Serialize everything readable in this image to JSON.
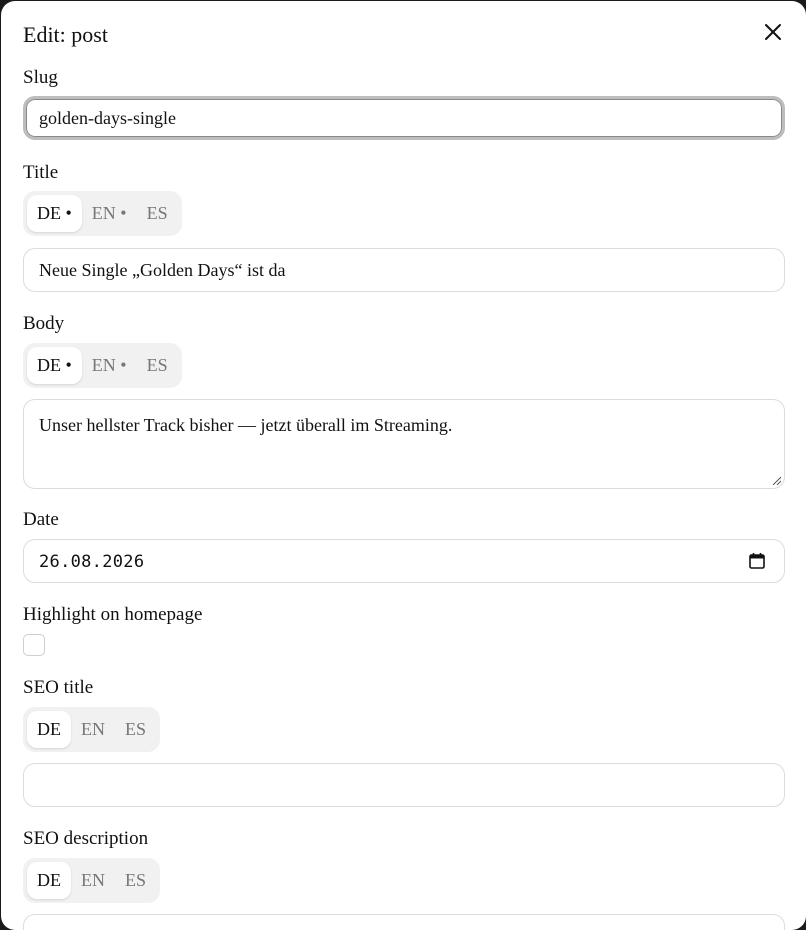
{
  "dialog": {
    "title": "Edit: post"
  },
  "slug": {
    "label": "Slug",
    "value": "golden-days-single"
  },
  "title_field": {
    "label": "Title",
    "tabs": [
      "DE •",
      "EN •",
      "ES"
    ],
    "active_tab": "DE",
    "value": "Neue Single „Golden Days“ ist da"
  },
  "body_field": {
    "label": "Body",
    "tabs": [
      "DE •",
      "EN •",
      "ES"
    ],
    "active_tab": "DE",
    "value": "Unser hellster Track bisher — jetzt überall im Streaming."
  },
  "date_field": {
    "label": "Date",
    "value": "26.08.2026"
  },
  "highlight": {
    "label": "Highlight on homepage",
    "checked": false
  },
  "seo_title": {
    "label": "SEO title",
    "tabs": [
      "DE",
      "EN",
      "ES"
    ],
    "active_tab": "DE",
    "value": ""
  },
  "seo_description": {
    "label": "SEO description",
    "tabs": [
      "DE",
      "EN",
      "ES"
    ],
    "active_tab": "DE",
    "value": ""
  },
  "icons": {
    "close": "close-icon",
    "calendar": "calendar-icon",
    "resize": "resize-grip-icon"
  }
}
